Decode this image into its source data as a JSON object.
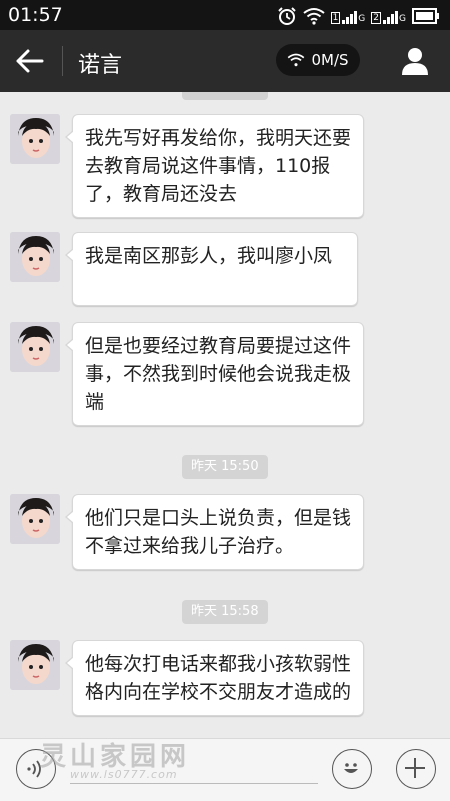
{
  "status_bar": {
    "time": "01:57",
    "icons": [
      "alarm-icon",
      "wifi-icon",
      "sim1-signal-icon",
      "sim2-signal-icon",
      "battery-icon"
    ],
    "sim1_label": "1",
    "sim1_net": "G",
    "sim2_label": "2",
    "sim2_net": "G"
  },
  "header": {
    "title": "诺言",
    "net_speed": "0M/S"
  },
  "messages": [
    {
      "type": "received",
      "text": "我先写好再发给你，我明天还要去教育局说这件事情，110报了，教育局还没去"
    },
    {
      "type": "received",
      "text": "我是南区那彭人，我叫廖小凤"
    },
    {
      "type": "received",
      "text": "但是也要经过教育局要提过这件事，不然我到时候他会说我走极端"
    },
    {
      "type": "timestamp",
      "text": "昨天 15:50"
    },
    {
      "type": "received",
      "text": "他们只是口头上说负责，但是钱不拿过来给我儿子治疗。"
    },
    {
      "type": "timestamp",
      "text": "昨天 15:58"
    },
    {
      "type": "received",
      "text": "他每次打电话来都我小孩软弱性格内向在学校不交朋友才造成的"
    }
  ],
  "watermark": {
    "text": "灵山家园网",
    "sub": "www.ls0777.com"
  },
  "colors": {
    "status_bar_bg": "#141414",
    "title_bar_bg": "#2b2b2b",
    "chat_bg": "#ebebeb",
    "bubble_bg": "#ffffff",
    "timestamp_bg": "#d4d4d4"
  }
}
